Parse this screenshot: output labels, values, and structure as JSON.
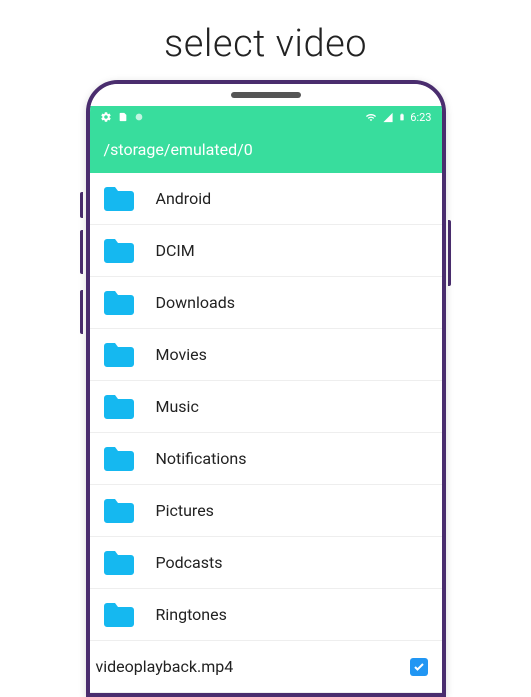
{
  "page": {
    "title": "select video"
  },
  "statusbar": {
    "time": "6:23"
  },
  "appbar": {
    "path": "/storage/emulated/0"
  },
  "folders": [
    {
      "name": "Android"
    },
    {
      "name": "DCIM"
    },
    {
      "name": "Downloads"
    },
    {
      "name": "Movies"
    },
    {
      "name": "Music"
    },
    {
      "name": "Notifications"
    },
    {
      "name": "Pictures"
    },
    {
      "name": "Podcasts"
    },
    {
      "name": "Ringtones"
    }
  ],
  "file": {
    "name": "videoplayback.mp4",
    "checked": true
  },
  "colors": {
    "accent": "#38dd9d",
    "folder": "#15b8f0",
    "checkbox": "#2196f3"
  }
}
